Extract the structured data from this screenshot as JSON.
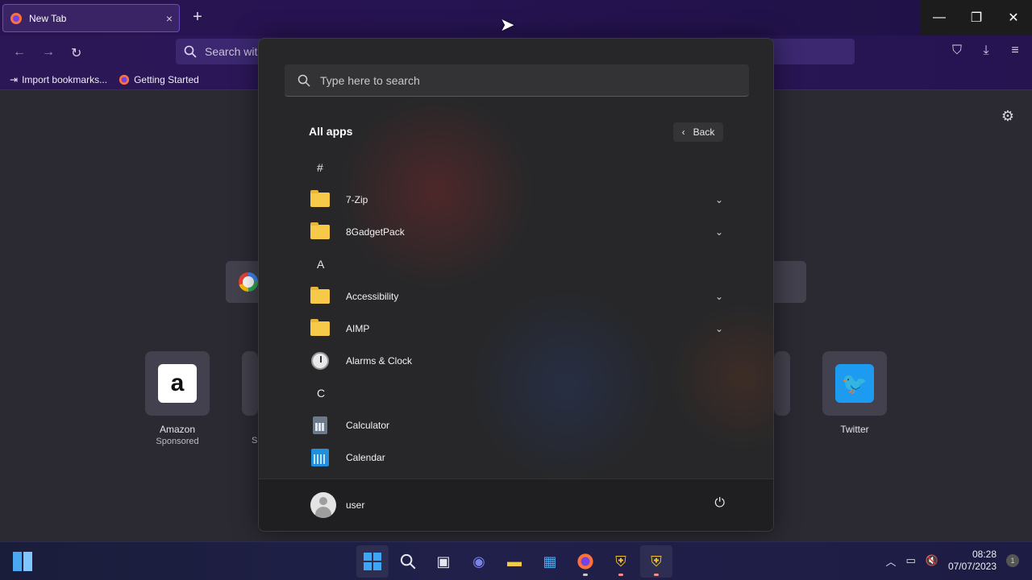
{
  "browser": {
    "tab_title": "New Tab",
    "tab_close": "×",
    "new_tab": "+",
    "window_controls": {
      "minimize": "—",
      "restore": "❐",
      "close": "✕"
    },
    "nav": {
      "back": "←",
      "forward": "→",
      "reload": "↻"
    },
    "urlbar_placeholder": "Search with",
    "toolbar_icons": [
      "pocket-icon",
      "download-icon",
      "menu-icon"
    ],
    "bookmarks": [
      {
        "label": "Import bookmarks...",
        "icon": "import-icon"
      },
      {
        "label": "Getting Started",
        "icon": "firefox-icon"
      }
    ]
  },
  "newtab": {
    "shortcuts": [
      {
        "label": "Amazon",
        "sub": "Sponsored"
      },
      {
        "label": "Twitter",
        "sub": ""
      }
    ],
    "partial_shortcut_sub": "Sp"
  },
  "start_menu": {
    "search_placeholder": "Type here to search",
    "title": "All apps",
    "back_label": "Back",
    "sections": [
      {
        "type": "letter",
        "text": "#"
      },
      {
        "type": "app",
        "name": "7-Zip",
        "icon": "folder",
        "expandable": true
      },
      {
        "type": "app",
        "name": "8GadgetPack",
        "icon": "folder",
        "expandable": true
      },
      {
        "type": "letter",
        "text": "A"
      },
      {
        "type": "app",
        "name": "Accessibility",
        "icon": "folder",
        "expandable": true
      },
      {
        "type": "app",
        "name": "AIMP",
        "icon": "folder",
        "expandable": true
      },
      {
        "type": "app",
        "name": "Alarms & Clock",
        "icon": "clock",
        "expandable": false
      },
      {
        "type": "letter",
        "text": "C"
      },
      {
        "type": "app",
        "name": "Calculator",
        "icon": "calculator",
        "expandable": false
      },
      {
        "type": "app",
        "name": "Calendar",
        "icon": "calendar",
        "expandable": false
      }
    ],
    "user": "user"
  },
  "taskbar": {
    "apps": [
      "start",
      "search",
      "task-view",
      "meet",
      "file-explorer",
      "store",
      "firefox",
      "security-shield",
      "security-shield-active"
    ],
    "time": "08:28",
    "date": "07/07/2023",
    "notification_count": "1"
  },
  "colors": {
    "accent": "#6a4bc4",
    "start_bg": "#272729",
    "folder": "#f7c948"
  }
}
